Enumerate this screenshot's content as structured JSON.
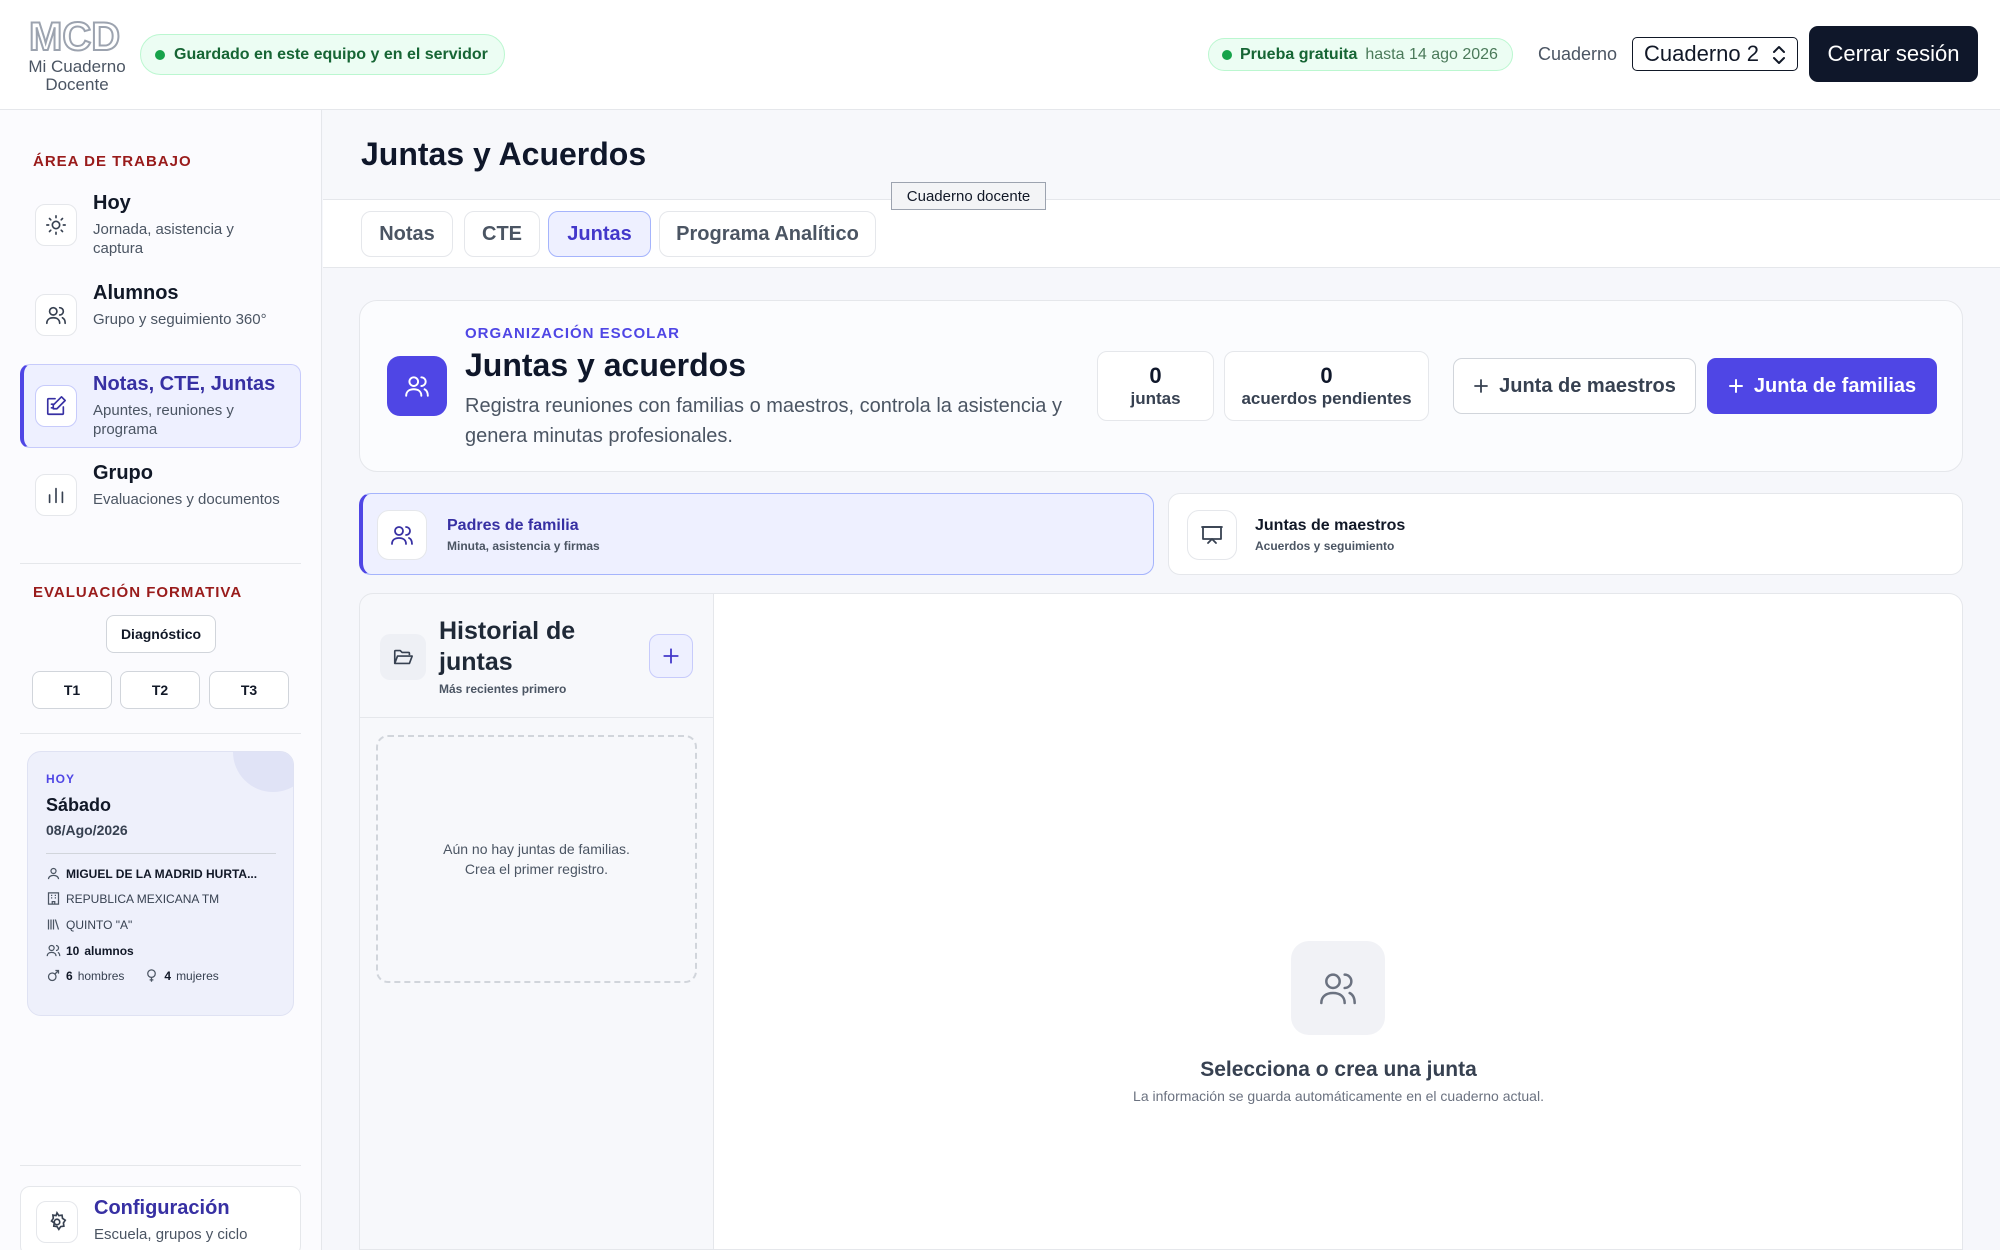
{
  "header": {
    "logo_letters": "MCD",
    "logo_line1": "Mi Cuaderno",
    "logo_line2": "Docente",
    "save_status": "Guardado en este equipo y en el servidor",
    "trial_label": "Prueba gratuita",
    "trial_until": "hasta 14 ago 2026",
    "notebook_label": "Cuaderno",
    "notebook_selected": "Cuaderno 2",
    "logout_label": "Cerrar sesión"
  },
  "sidebar": {
    "workspace_title": "ÁREA DE TRABAJO",
    "items": [
      {
        "title": "Hoy",
        "subtitle": "Jornada, asistencia y captura",
        "icon": "sun-icon"
      },
      {
        "title": "Alumnos",
        "subtitle": "Grupo y seguimiento 360°",
        "icon": "users-icon"
      },
      {
        "title": "Notas, CTE, Juntas",
        "subtitle": "Apuntes, reuniones y programa",
        "icon": "edit-note-icon",
        "active": true
      },
      {
        "title": "Grupo",
        "subtitle": "Evaluaciones y documentos",
        "icon": "bar-chart-icon"
      }
    ],
    "evaluation_title": "EVALUACIÓN FORMATIVA",
    "diagnostic_label": "Diagnóstico",
    "trimesters": [
      "T1",
      "T2",
      "T3"
    ],
    "today": {
      "label": "HOY",
      "day": "Sábado",
      "date": "08/Ago/2026",
      "teacher": "MIGUEL DE LA MADRID HURTA...",
      "school": "REPUBLICA MEXICANA TM",
      "group": "QUINTO \"A\"",
      "students_count": "10",
      "students_label": "alumnos",
      "men_count": "6",
      "men_label": "hombres",
      "women_count": "4",
      "women_label": "mujeres"
    },
    "config": {
      "title": "Configuración",
      "subtitle": "Escuela, grupos y ciclo",
      "icon": "gear-icon"
    }
  },
  "main": {
    "page_title": "Juntas y Acuerdos",
    "tabs": [
      {
        "label": "Notas"
      },
      {
        "label": "CTE"
      },
      {
        "label": "Juntas",
        "active": true
      },
      {
        "label": "Programa Analítico"
      }
    ],
    "tooltip": "Cuaderno docente",
    "summary": {
      "section_label": "ORGANIZACIÓN ESCOLAR",
      "title": "Juntas y acuerdos",
      "description": "Registra reuniones con familias o maestros, controla la asistencia y genera minutas profesionales.",
      "meetings_count": "0",
      "meetings_label": "juntas",
      "pending_count": "0",
      "pending_label": "acuerdos pendientes",
      "btn_teachers": "Junta de maestros",
      "btn_families": "Junta de familias"
    },
    "types": [
      {
        "title": "Padres de familia",
        "subtitle": "Minuta, asistencia y firmas",
        "active": true
      },
      {
        "title": "Juntas de maestros",
        "subtitle": "Acuerdos y seguimiento"
      }
    ],
    "history": {
      "title": "Historial de juntas",
      "subtitle": "Más recientes primero",
      "empty_line1": "Aún no hay juntas de familias.",
      "empty_line2": "Crea el primer registro."
    },
    "detail": {
      "title": "Selecciona o crea una junta",
      "subtitle": "La información se guarda automáticamente en el cuaderno actual."
    }
  },
  "colors": {
    "accent": "#4f46e5",
    "dark": "#0f172a",
    "success": "#16a34a",
    "section_red": "#991b1b"
  }
}
